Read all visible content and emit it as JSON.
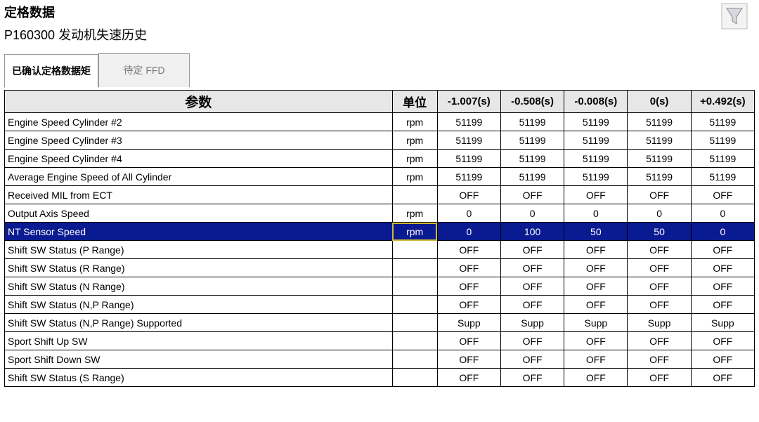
{
  "header": {
    "title1": "定格数据",
    "title2": "P160300  发动机失速历史"
  },
  "tabs": {
    "active": "已确认定格数据矩",
    "inactive": "待定 FFD"
  },
  "columns": {
    "param": "参数",
    "unit": "单位",
    "times": [
      "-1.007(s)",
      "-0.508(s)",
      "-0.008(s)",
      "0(s)",
      "+0.492(s)"
    ]
  },
  "rows": [
    {
      "param": "Engine Speed Cylinder #2",
      "unit": "rpm",
      "vals": [
        "51199",
        "51199",
        "51199",
        "51199",
        "51199"
      ]
    },
    {
      "param": "Engine Speed Cylinder #3",
      "unit": "rpm",
      "vals": [
        "51199",
        "51199",
        "51199",
        "51199",
        "51199"
      ]
    },
    {
      "param": "Engine Speed Cylinder #4",
      "unit": "rpm",
      "vals": [
        "51199",
        "51199",
        "51199",
        "51199",
        "51199"
      ]
    },
    {
      "param": "Average Engine Speed of All Cylinder",
      "unit": "rpm",
      "vals": [
        "51199",
        "51199",
        "51199",
        "51199",
        "51199"
      ]
    },
    {
      "param": "Received MIL from ECT",
      "unit": "",
      "vals": [
        "OFF",
        "OFF",
        "OFF",
        "OFF",
        "OFF"
      ]
    },
    {
      "param": "Output Axis Speed",
      "unit": "rpm",
      "vals": [
        "0",
        "0",
        "0",
        "0",
        "0"
      ]
    },
    {
      "param": "NT Sensor Speed",
      "unit": "rpm",
      "vals": [
        "0",
        "100",
        "50",
        "50",
        "0"
      ],
      "selected": true
    },
    {
      "param": "Shift SW Status (P Range)",
      "unit": "",
      "vals": [
        "OFF",
        "OFF",
        "OFF",
        "OFF",
        "OFF"
      ]
    },
    {
      "param": "Shift SW Status (R Range)",
      "unit": "",
      "vals": [
        "OFF",
        "OFF",
        "OFF",
        "OFF",
        "OFF"
      ]
    },
    {
      "param": "Shift SW Status (N Range)",
      "unit": "",
      "vals": [
        "OFF",
        "OFF",
        "OFF",
        "OFF",
        "OFF"
      ]
    },
    {
      "param": "Shift SW Status (N,P Range)",
      "unit": "",
      "vals": [
        "OFF",
        "OFF",
        "OFF",
        "OFF",
        "OFF"
      ]
    },
    {
      "param": "Shift SW Status (N,P Range) Supported",
      "unit": "",
      "vals": [
        "Supp",
        "Supp",
        "Supp",
        "Supp",
        "Supp"
      ]
    },
    {
      "param": "Sport Shift Up SW",
      "unit": "",
      "vals": [
        "OFF",
        "OFF",
        "OFF",
        "OFF",
        "OFF"
      ]
    },
    {
      "param": "Sport Shift Down SW",
      "unit": "",
      "vals": [
        "OFF",
        "OFF",
        "OFF",
        "OFF",
        "OFF"
      ]
    },
    {
      "param": "Shift SW Status (S Range)",
      "unit": "",
      "vals": [
        "OFF",
        "OFF",
        "OFF",
        "OFF",
        "OFF"
      ]
    }
  ]
}
